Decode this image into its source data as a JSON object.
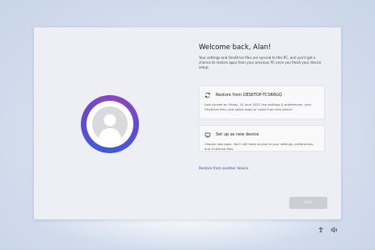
{
  "header": {
    "title": "Welcome back, Alan!",
    "subtitle": "Your settings and OneDrive files are synced to this PC, and you'll get a chance to restore apps from your previous PC once you finish your device setup."
  },
  "options": {
    "restore": {
      "icon": "sync-icon",
      "title": "Restore from DESKTOP-TCSR6GQ",
      "body": "Last synced on Friday, 10 June 2022 Use settings & preferences, sync OneDrive files, and select apps to install from this device."
    },
    "new_device": {
      "icon": "new-device-icon",
      "title": "Set up as new device",
      "body": "Choose new apps. You'll still have access to your settings, preferences, and OneDrive files."
    }
  },
  "links": {
    "restore_another": "Restore from another device"
  },
  "buttons": {
    "next": "Next"
  },
  "avatar": {
    "icon": "user-avatar-icon"
  },
  "tray": {
    "accessibility_icon": "accessibility-icon",
    "volume_icon": "speaker-icon"
  },
  "colors": {
    "accent_ring_start": "#3d5bd6",
    "accent_ring_end": "#8a46c0",
    "link": "#2a4fa8",
    "button_disabled": "#cdced3",
    "window_background": "#eeeff4"
  }
}
